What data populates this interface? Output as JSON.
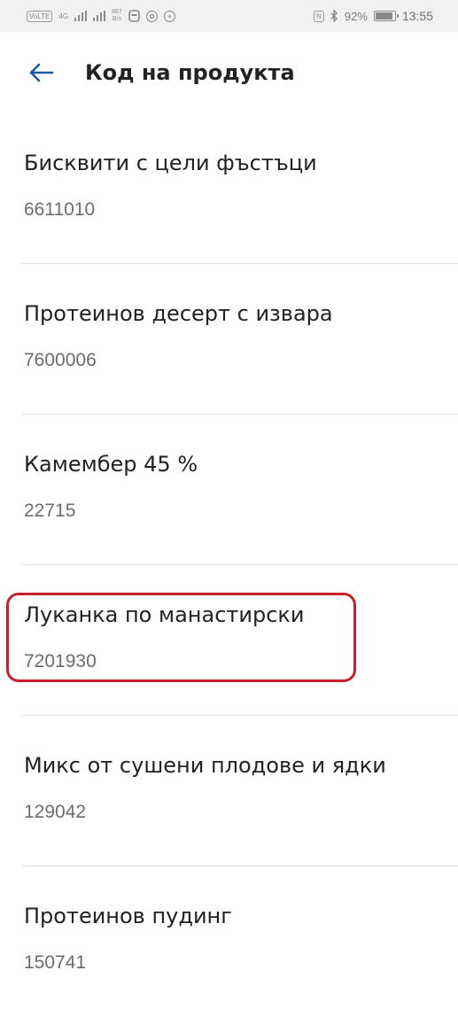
{
  "status_bar": {
    "carrier_chip": "VoLTE",
    "network_type": "4G",
    "speed_value": "887",
    "speed_unit": "B/s",
    "nfc": "N",
    "battery_percent": "92%",
    "battery_level": 0.92,
    "time": "13:55"
  },
  "header": {
    "back_icon": "arrow-left-icon",
    "title": "Код на продукта"
  },
  "colors": {
    "accent": "#1a5aa6",
    "highlight": "#c8202a"
  },
  "products": [
    {
      "name": "Бисквити с цели фъстъци",
      "code": "6611010"
    },
    {
      "name": "Протеинов десерт с извара",
      "code": "7600006"
    },
    {
      "name": "Камембер 45 %",
      "code": "22715"
    },
    {
      "name": "Луканка по манастирски",
      "code": "7201930"
    },
    {
      "name": "Микс от сушени плодове и ядки",
      "code": "129042"
    },
    {
      "name": "Протеинов пудинг",
      "code": "150741"
    }
  ]
}
